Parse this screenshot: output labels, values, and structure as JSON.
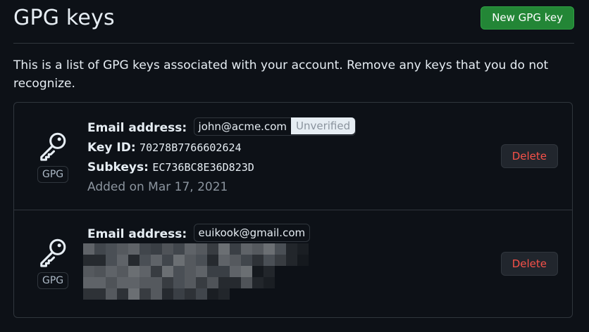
{
  "header": {
    "title": "GPG keys",
    "new_key_label": "New GPG key"
  },
  "intro": "This is a list of GPG keys associated with your account. Remove any keys that you do not recognize.",
  "colors": {
    "background": "#0d1117",
    "primary_button": "#238636",
    "danger_text": "#f85149",
    "border": "#30363d"
  },
  "keys": [
    {
      "icon": "key-icon",
      "type_badge": "GPG",
      "email_label": "Email address:",
      "email": "john@acme.com",
      "verification": "Unverified",
      "key_id_label": "Key ID:",
      "key_id": "70278B7766602624",
      "subkeys_label": "Subkeys:",
      "subkeys": "EC736BC8E36D823D",
      "added": "Added on Mar 17, 2021",
      "delete_label": "Delete"
    },
    {
      "icon": "key-icon",
      "type_badge": "GPG",
      "email_label": "Email address:",
      "email": "euikook@gmail.com",
      "delete_label": "Delete"
    }
  ]
}
